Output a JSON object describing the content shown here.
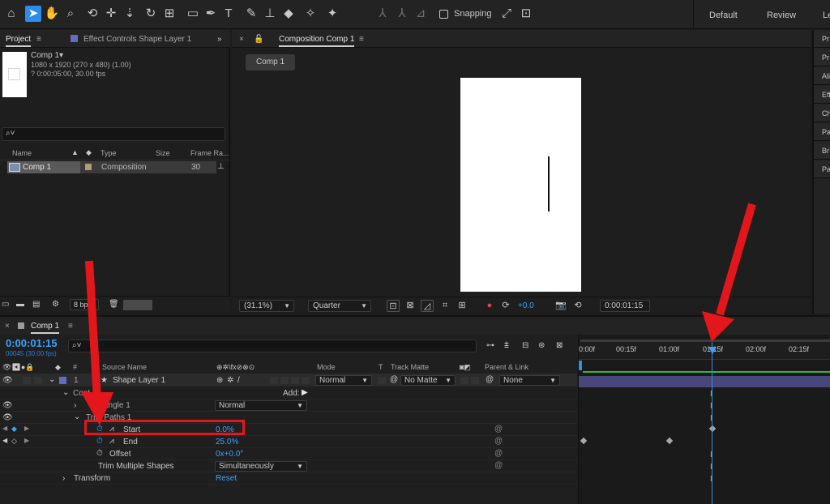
{
  "toolbar": {
    "snapping_label": "Snapping",
    "workspaces": [
      "Default",
      "Review",
      "Le"
    ]
  },
  "project_panel": {
    "tab_project": "Project",
    "tab_effect_controls": "Effect Controls Shape Layer 1",
    "comp_name": "Comp 1▾",
    "comp_info_1": "1080 x 1920  (270 x 480) (1.00)",
    "comp_info_2": "? 0:00:05:00, 30.00 fps",
    "search_placeholder": "⌕˅",
    "columns": {
      "name": "Name",
      "type": "Type",
      "size": "Size",
      "frame_rate": "Frame Ra..."
    },
    "row": {
      "name": "Comp 1",
      "type": "Composition",
      "frame_rate": "30"
    },
    "footer_bpc": "8 bpc"
  },
  "comp_panel": {
    "tab_title": "Composition Comp 1",
    "pill": "Comp 1",
    "zoom": "(31.1%)",
    "resolution": "Quarter",
    "exposure": "+0.0",
    "timecode": "0:00:01:15"
  },
  "right_panel": {
    "items": [
      "Pr",
      "Pr",
      "Ali",
      "Eff",
      "Ch",
      "Pa",
      "Br",
      "Pa"
    ]
  },
  "timeline": {
    "tab_title": "Comp 1",
    "timecode": "0:00:01:15",
    "frames": "00045 (30.00 fps)",
    "columns": {
      "num": "#",
      "source_name": "Source Name",
      "mode": "Mode",
      "t": "T",
      "track_matte": "Track Matte",
      "parent_link": "Parent & Link"
    },
    "layer": {
      "num": "1",
      "name": "Shape Layer 1",
      "mode": "Normal",
      "track_matte": "No Matte",
      "parent": "None"
    },
    "contents_label": "Cont",
    "add_label": "Add:",
    "rect_label": "angle 1",
    "rect_blend": "Normal",
    "trim_label": "Trim Paths 1",
    "start_label": "Start",
    "start_value": "0.0%",
    "end_label": "End",
    "end_value": "25.0%",
    "offset_label": "Offset",
    "offset_value": "0x+0.0°",
    "trim_multiple_label": "Trim Multiple Shapes",
    "trim_multiple_value": "Simultaneously",
    "transform_label": "Transform",
    "transform_value": "Reset",
    "ruler_ticks": [
      "0:00f",
      "00:15f",
      "01:00f",
      "01:15f",
      "02:00f",
      "02:15f"
    ]
  }
}
